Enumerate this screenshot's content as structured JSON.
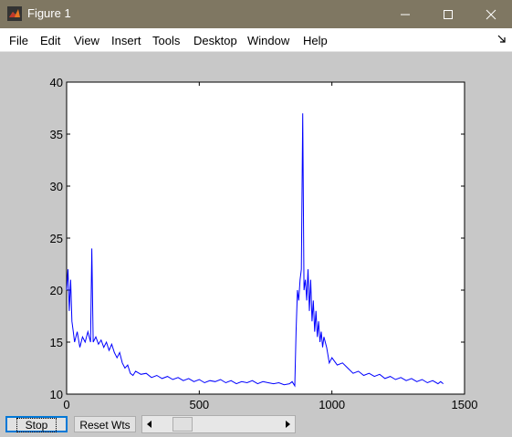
{
  "window": {
    "title": "Figure 1"
  },
  "titlebar_buttons": [
    "minimize-icon",
    "maximize-icon",
    "close-icon"
  ],
  "menu": {
    "items": [
      "File",
      "Edit",
      "View",
      "Insert",
      "Tools",
      "Desktop",
      "Window",
      "Help"
    ]
  },
  "controls": {
    "stop_label": "Stop",
    "reset_label": "Reset Wts",
    "slider_value": 0.15
  },
  "colors": {
    "titlebar": "#7f7762",
    "figure_bg": "#c8c8c8",
    "line": "#0000ff"
  },
  "chart_data": {
    "type": "line",
    "title": "",
    "xlabel": "",
    "ylabel": "",
    "xlim": [
      0,
      1500
    ],
    "ylim": [
      10,
      40
    ],
    "xticks": [
      0,
      500,
      1000,
      1500
    ],
    "yticks": [
      10,
      15,
      20,
      25,
      30,
      35,
      40
    ],
    "grid": false,
    "series": [
      {
        "color": "#0000ff",
        "x": [
          0,
          5,
          10,
          15,
          20,
          25,
          30,
          40,
          50,
          60,
          70,
          80,
          90,
          95,
          100,
          110,
          120,
          130,
          140,
          150,
          160,
          170,
          180,
          190,
          200,
          210,
          220,
          230,
          240,
          250,
          260,
          280,
          300,
          320,
          340,
          360,
          380,
          400,
          420,
          440,
          460,
          480,
          500,
          520,
          540,
          560,
          580,
          600,
          620,
          640,
          660,
          680,
          700,
          720,
          740,
          760,
          780,
          800,
          820,
          840,
          850,
          860,
          865,
          870,
          875,
          880,
          885,
          890,
          895,
          900,
          905,
          910,
          915,
          920,
          925,
          930,
          935,
          940,
          945,
          950,
          955,
          960,
          965,
          970,
          980,
          990,
          1000,
          1020,
          1040,
          1060,
          1080,
          1100,
          1120,
          1140,
          1160,
          1180,
          1200,
          1220,
          1240,
          1260,
          1280,
          1300,
          1320,
          1340,
          1360,
          1380,
          1400,
          1410,
          1420
        ],
        "y": [
          20,
          22,
          18,
          21,
          17,
          16,
          15,
          16,
          14.5,
          15.5,
          15,
          16,
          15,
          24,
          15,
          15.5,
          14.8,
          15.2,
          14.5,
          15,
          14.2,
          14.8,
          14,
          13.5,
          14,
          13,
          12.5,
          12.8,
          12,
          11.8,
          12.2,
          11.9,
          12,
          11.6,
          11.8,
          11.5,
          11.7,
          11.4,
          11.6,
          11.3,
          11.5,
          11.2,
          11.4,
          11.1,
          11.3,
          11.2,
          11.4,
          11.1,
          11.3,
          11.0,
          11.2,
          11.1,
          11.3,
          11.0,
          11.2,
          11.1,
          11.0,
          11.1,
          10.9,
          11.0,
          11.2,
          10.8,
          16,
          20,
          19,
          21,
          22,
          37,
          20,
          21,
          19,
          22,
          18,
          21,
          17,
          19,
          16,
          18,
          15.5,
          17,
          15,
          16,
          14.5,
          15.5,
          14.5,
          13,
          13.5,
          12.8,
          13,
          12.5,
          12,
          12.2,
          11.8,
          12,
          11.7,
          11.9,
          11.5,
          11.7,
          11.4,
          11.6,
          11.3,
          11.5,
          11.2,
          11.4,
          11.1,
          11.3,
          11.0,
          11.2,
          11.0
        ]
      }
    ]
  }
}
